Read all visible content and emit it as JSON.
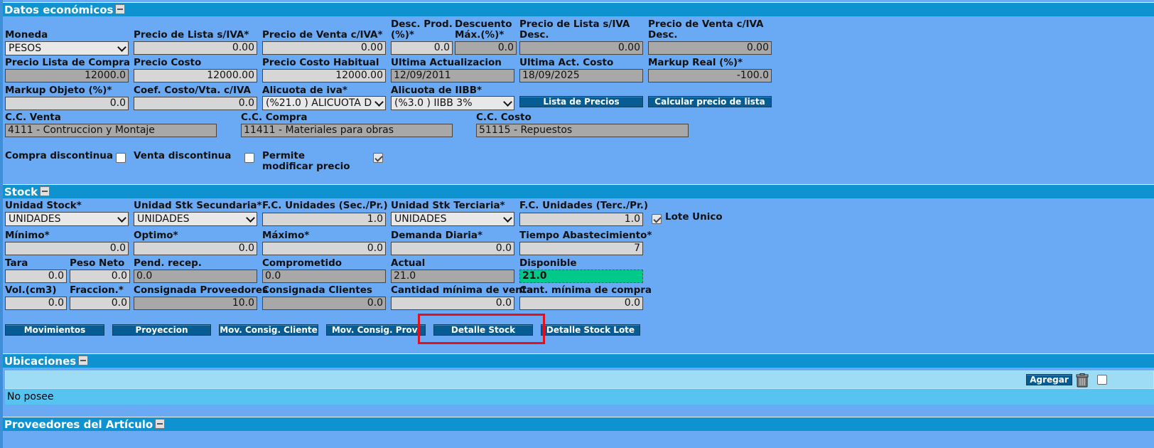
{
  "datos": {
    "title": "Datos económicos",
    "moneda": {
      "label": "Moneda",
      "value": "PESOS"
    },
    "precio_lista_siva": {
      "label": "Precio de Lista s/IVA*",
      "value": "0.00"
    },
    "precio_venta_civa": {
      "label": "Precio de Venta c/IVA*",
      "value": "0.00"
    },
    "desc_prod": {
      "label": "Desc. Prod. (%)*",
      "value": "0.0"
    },
    "descuento_max": {
      "label": "Descuento Máx.(%)*",
      "value": "0.0"
    },
    "precio_lista_siva_desc": {
      "label": "Precio de Lista s/IVA Desc.",
      "value": "0.00"
    },
    "precio_venta_civa_desc": {
      "label": "Precio de Venta c/IVA Desc.",
      "value": "0.00"
    },
    "precio_lista_compra": {
      "label": "Precio Lista de Compra",
      "value": "12000.0"
    },
    "precio_costo": {
      "label": "Precio Costo",
      "value": "12000.00"
    },
    "precio_costo_habitual": {
      "label": "Precio Costo Habitual",
      "value": "12000.00"
    },
    "ultima_actualizacion": {
      "label": "Ultima Actualizacion",
      "value": "12/09/2011"
    },
    "ultima_act_costo": {
      "label": "Ultima Act. Costo",
      "value": "18/09/2025"
    },
    "markup_real": {
      "label": "Markup Real (%)*",
      "value": "-100.0"
    },
    "markup_objeto": {
      "label": "Markup Objeto (%)*",
      "value": "0.0"
    },
    "coef_costo": {
      "label": "Coef. Costo/Vta. c/IVA",
      "value": "0.0"
    },
    "alicuota_iva": {
      "label": "Alicuota de iva*",
      "value": "(%21.0 ) ALICUOTA D"
    },
    "alicuota_iibb": {
      "label": "Alicuota de IIBB*",
      "value": "(%3.0 ) IIBB 3%"
    },
    "btn_lista_precios": "Lista de Precios",
    "btn_calcular": "Calcular precio de lista",
    "cc_venta": {
      "label": "C.C. Venta",
      "value": "4111 - Contruccion y Montaje"
    },
    "cc_compra": {
      "label": "C.C. Compra",
      "value": "11411 - Materiales para obras"
    },
    "cc_costo": {
      "label": "C.C. Costo",
      "value": "51115 - Repuestos"
    },
    "compra_discontinua": "Compra discontinua",
    "venta_discontinua": "Venta discontinua",
    "permite_modificar": "Permite modificar precio"
  },
  "stock": {
    "title": "Stock",
    "unidad_stock": {
      "label": "Unidad Stock*",
      "value": "UNIDADES"
    },
    "unidad_sec": {
      "label": "Unidad Stk Secundaria*",
      "value": "UNIDADES"
    },
    "fc_sec": {
      "label": "F.C. Unidades (Sec./Pr.)",
      "value": "1.0"
    },
    "unidad_ter": {
      "label": "Unidad Stk Terciaria*",
      "value": "UNIDADES"
    },
    "fc_ter": {
      "label": "F.C. Unidades (Terc./Pr.)",
      "value": "1.0"
    },
    "lote_unico": "Lote Unico",
    "minimo": {
      "label": "Mínimo*",
      "value": "0.0"
    },
    "optimo": {
      "label": "Optimo*",
      "value": "0.0"
    },
    "maximo": {
      "label": "Máximo*",
      "value": "0.0"
    },
    "demanda": {
      "label": "Demanda Diaria*",
      "value": "0.0"
    },
    "tiempo": {
      "label": "Tiempo Abastecimiento*",
      "value": "7"
    },
    "tara": {
      "label": "Tara",
      "value": "0.0"
    },
    "peso_neto": {
      "label": "Peso Neto",
      "value": "0.0"
    },
    "pend_recep": {
      "label": "Pend. recep.",
      "value": "0.0"
    },
    "comprometido": {
      "label": "Comprometido",
      "value": "0.0"
    },
    "actual": {
      "label": "Actual",
      "value": "21.0"
    },
    "disponible": {
      "label": "Disponible",
      "value": "21.0"
    },
    "vol": {
      "label": "Vol.(cm3)",
      "value": "0.0"
    },
    "fraccion": {
      "label": "Fraccion.*",
      "value": "0.0"
    },
    "consig_prov": {
      "label": "Consignada Proveedores",
      "value": "10.0"
    },
    "consig_cli": {
      "label": "Consignada Clientes",
      "value": "0.0"
    },
    "cant_min_venta": {
      "label": "Cantidad mínima de venta",
      "value": "0.0"
    },
    "cant_min_compra": {
      "label": "Cant. mínima de compra",
      "value": "0.0"
    },
    "buttons": {
      "movimientos": "Movimientos",
      "proyeccion": "Proyeccion",
      "mov_consig_cliente": "Mov. Consig. Cliente",
      "mov_consig_prov": "Mov. Consig. Prov.",
      "detalle_stock": "Detalle Stock",
      "detalle_stock_lote": "Detalle Stock Lote"
    }
  },
  "ubicaciones": {
    "title": "Ubicaciones",
    "agregar": "Agregar",
    "empty": "No posee"
  },
  "proveedores": {
    "title": "Proveedores del Artículo"
  },
  "colors": {
    "header": "#0e92d0",
    "panel": "#6aaaf5",
    "button": "#075d93",
    "highlight": "#e5101a",
    "available": "#00c98a"
  }
}
